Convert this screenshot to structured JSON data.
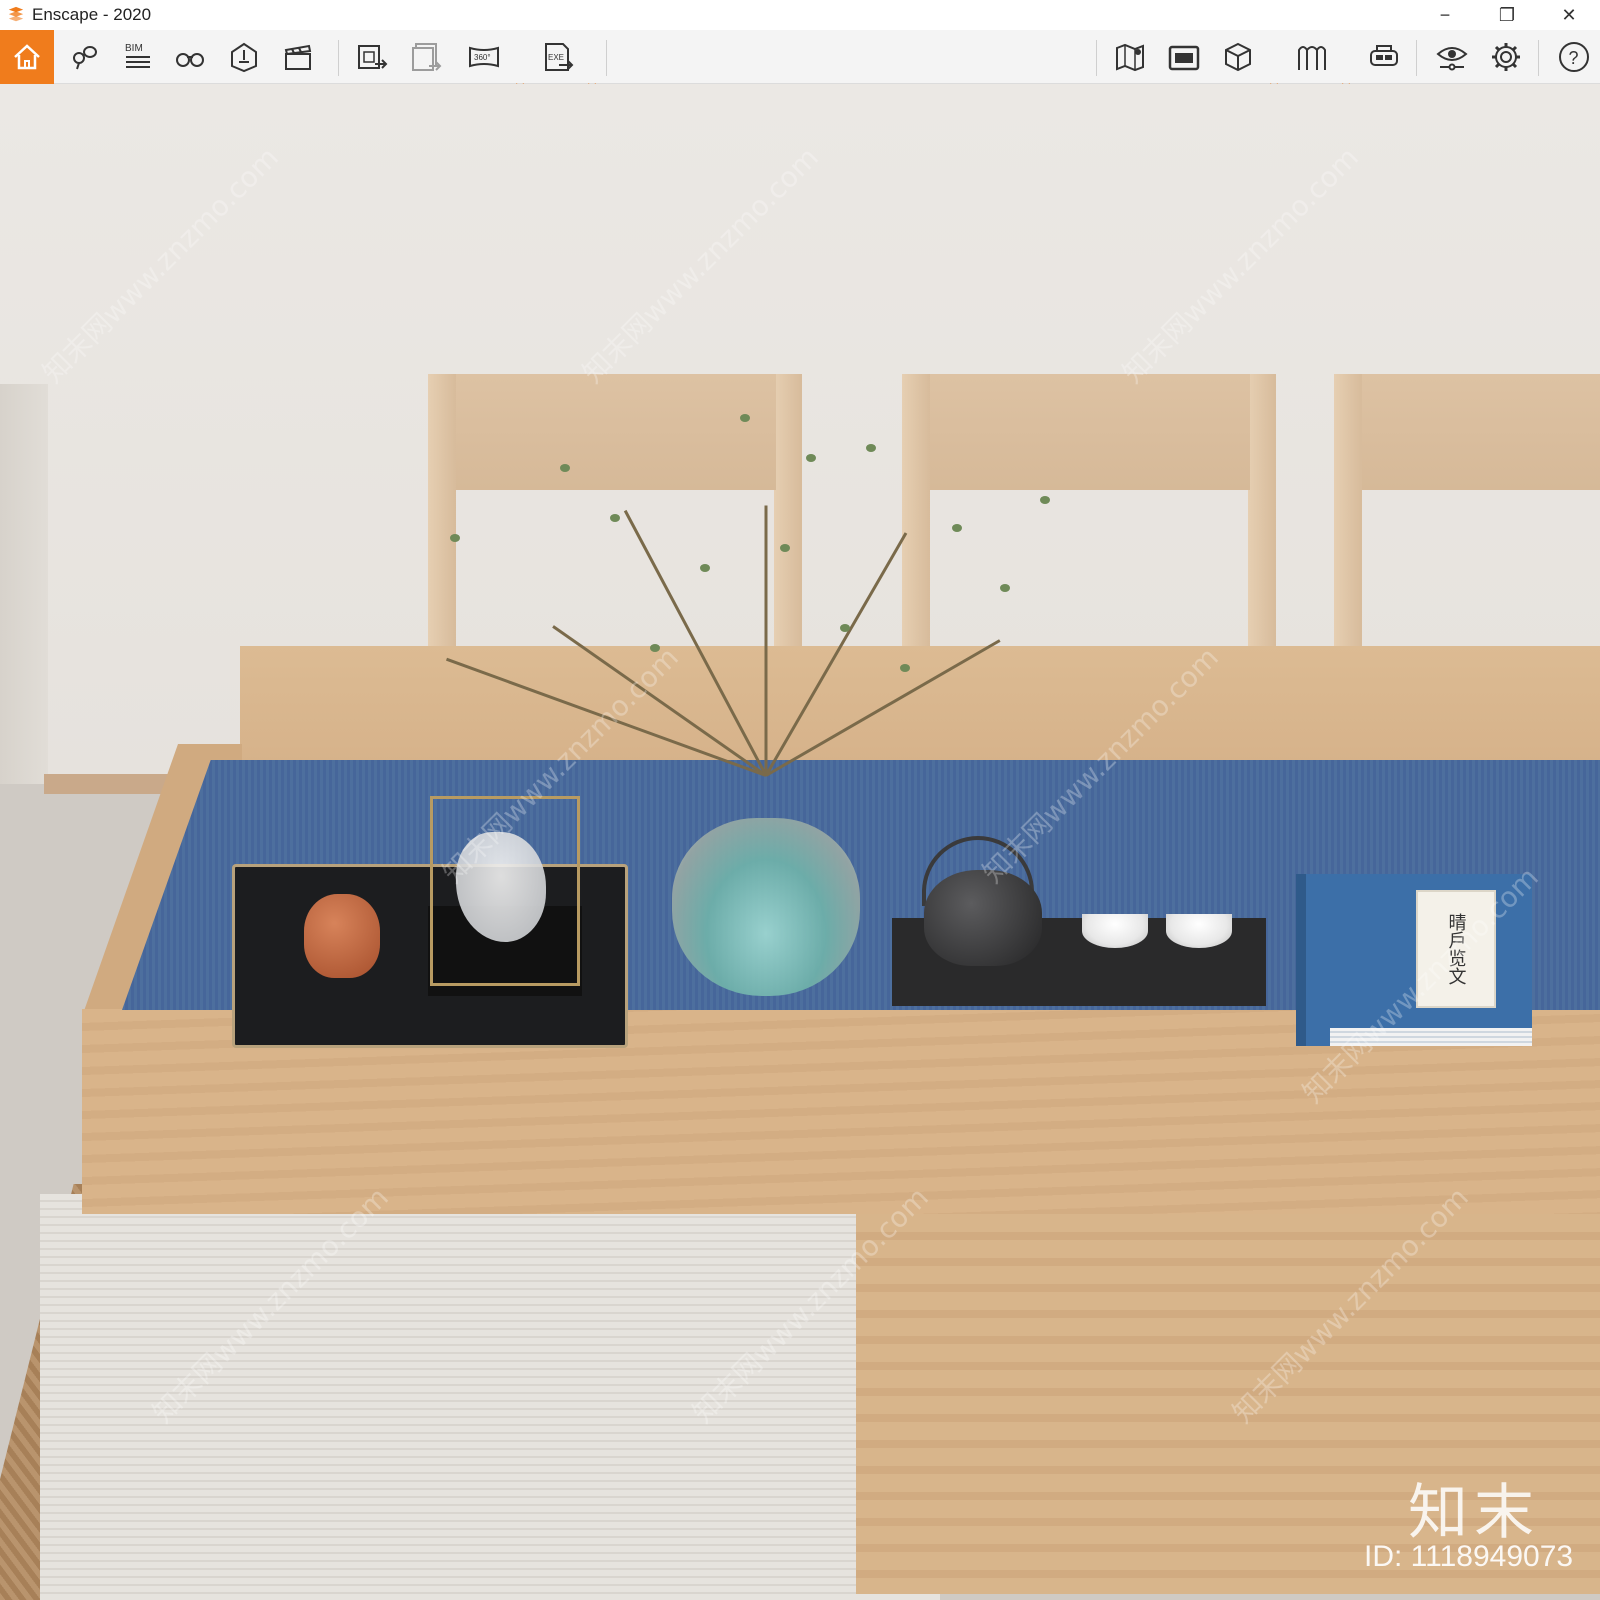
{
  "window": {
    "title": "Enscape - 2020",
    "controls": {
      "minimize": "−",
      "restore": "❐",
      "close": "✕"
    }
  },
  "toolbar": {
    "left_group": [
      {
        "name": "home-icon"
      },
      {
        "name": "location-pins-icon"
      },
      {
        "name": "bim-icon",
        "label": "BIM"
      },
      {
        "name": "binoculars-icon"
      },
      {
        "name": "light-view-icon"
      },
      {
        "name": "clapperboard-icon"
      }
    ],
    "export_group": [
      {
        "name": "export-image-icon"
      },
      {
        "name": "batch-export-icon"
      },
      {
        "name": "panorama-360-icon",
        "label": "360°"
      },
      {
        "name": "exe-export-icon",
        "label": "EXE"
      }
    ],
    "right_group": [
      {
        "name": "map-icon"
      },
      {
        "name": "asset-library-icon"
      },
      {
        "name": "cube-icon"
      },
      {
        "name": "section-icon"
      },
      {
        "name": "vr-headset-icon"
      },
      {
        "name": "visual-settings-icon"
      },
      {
        "name": "settings-gear-icon"
      },
      {
        "name": "help-icon",
        "label": "?"
      }
    ],
    "accent_color": "#f07c1c"
  },
  "scene": {
    "book_cover_text": "晴戶览文",
    "watermark_text": "知末网www.znzmo.com",
    "brand": "知末",
    "image_id": "ID: 1118949073"
  }
}
